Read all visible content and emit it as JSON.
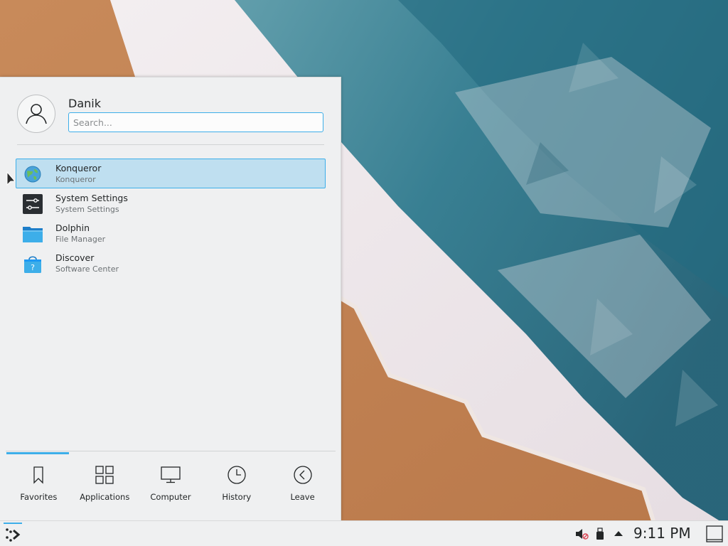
{
  "launcher": {
    "username": "Danik",
    "search_placeholder": "Search...",
    "favorites": [
      {
        "title": "Konqueror",
        "subtitle": "Konqueror",
        "icon": "konqueror-globe-icon",
        "selected": true
      },
      {
        "title": "System Settings",
        "subtitle": "System Settings",
        "icon": "system-settings-icon",
        "selected": false
      },
      {
        "title": "Dolphin",
        "subtitle": "File Manager",
        "icon": "folder-icon",
        "selected": false
      },
      {
        "title": "Discover",
        "subtitle": "Software Center",
        "icon": "software-center-bag-icon",
        "selected": false
      }
    ],
    "tabs": [
      {
        "label": "Favorites",
        "icon": "bookmark-icon",
        "active": true
      },
      {
        "label": "Applications",
        "icon": "grid-icon",
        "active": false
      },
      {
        "label": "Computer",
        "icon": "monitor-icon",
        "active": false
      },
      {
        "label": "History",
        "icon": "clock-icon",
        "active": false
      },
      {
        "label": "Leave",
        "icon": "back-arrow-icon",
        "active": false
      }
    ]
  },
  "panel": {
    "clock": "9:11 PM",
    "tray_icons": [
      "volume-muted-icon",
      "usb-device-icon",
      "expand-tray-arrow-icon"
    ]
  },
  "colors": {
    "accent": "#3daee9",
    "selection": "#bfdff0",
    "background": "#eff0f1",
    "text": "#232627"
  }
}
